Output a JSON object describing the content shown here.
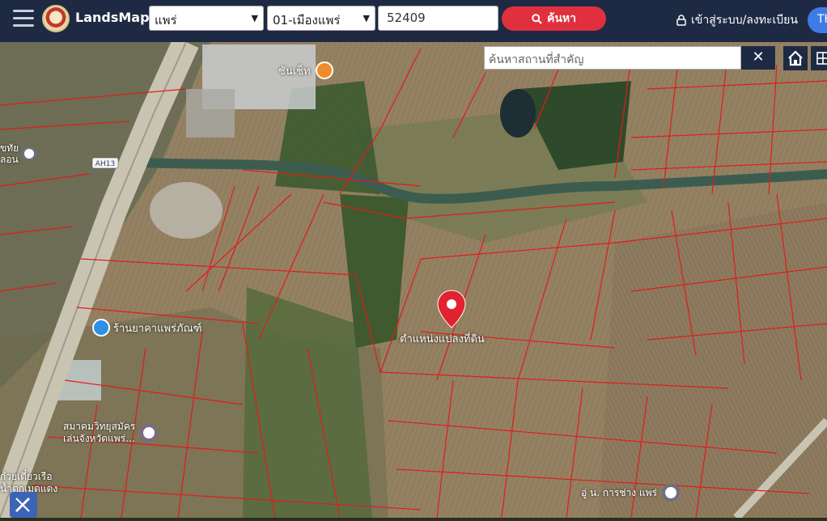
{
  "header": {
    "brand": "LandsMaps",
    "province": "แพร่",
    "district": "01-เมืองแพร่",
    "parcel_number": "52409",
    "search_label": "ค้นหา",
    "login_label": "เข้าสู่ระบบ/ลงทะเบียน",
    "lang_label": "TH"
  },
  "map_toolbar": {
    "place_search_placeholder": "ค้นหาสถานที่สำคัญ",
    "clear_symbol": "✕",
    "home_icon": "home-icon",
    "layers_icon": "grid-icon"
  },
  "map": {
    "road_shield": "AH13",
    "marker_label": "ตำแหน่งแปลงที่ดิน",
    "pois": [
      {
        "label": "ชันเช็ท",
        "icon": "restaurant-icon"
      },
      {
        "label": "ขทัย\nลอน",
        "icon": "place-icon"
      },
      {
        "label": "ร้านยาคาแพร่ภัณฑ์",
        "icon": "shop-icon"
      },
      {
        "label": "สมาคมวิทยุสมัคร\nเล่นจังหวัดแพร่...",
        "icon": "radio-icon"
      },
      {
        "label": "ก๋วยเตี๋ยวเรือ\nน้ำตกเมดแดง",
        "icon": "food-icon"
      },
      {
        "label": "อู่ น. การช่าง แพร่",
        "icon": "place-icon"
      }
    ]
  }
}
